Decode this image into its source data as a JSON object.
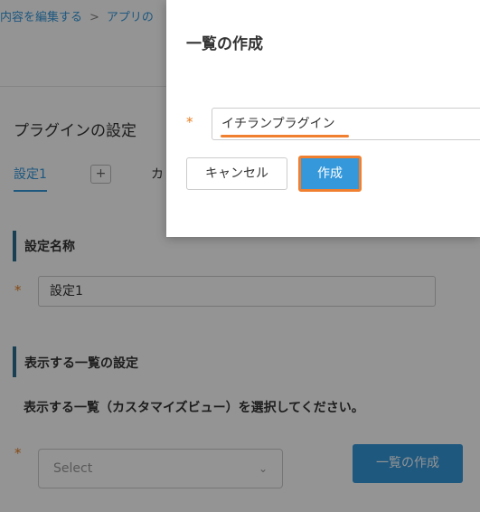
{
  "breadcrumb": {
    "items": [
      "内容を編集する",
      "アプリの"
    ],
    "separator": ">"
  },
  "plugin": {
    "title": "プラグインの設定",
    "tabs": [
      {
        "label": "設定1"
      },
      {
        "label": "+"
      },
      {
        "label": "カ"
      }
    ]
  },
  "setting_name": {
    "section_label": "設定名称",
    "required_mark": "*",
    "value": "設定1"
  },
  "list_setting": {
    "section_label": "表示する一覧の設定",
    "description": "表示する一覧（カスタマイズビュー）を選択してください。",
    "required_mark": "*",
    "select_placeholder": "Select",
    "create_button_label": "一覧の作成"
  },
  "modal": {
    "title": "一覧の作成",
    "required_mark": "*",
    "input_value": "イチランプラグイン",
    "cancel_label": "キャンセル",
    "create_label": "作成"
  },
  "colors": {
    "accent_blue": "#3498db",
    "highlight_orange": "#f08030",
    "required_orange": "#e67e22",
    "section_bar": "#2b6f8e"
  }
}
